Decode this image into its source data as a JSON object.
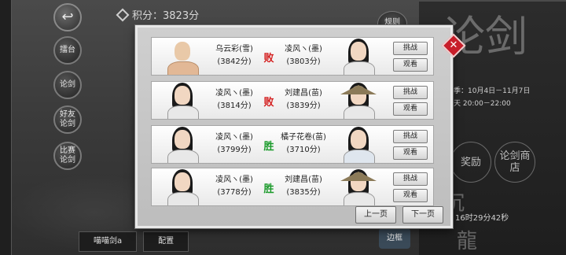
{
  "header": {
    "score_text": "积分：3823分",
    "top_tab": "规则"
  },
  "sidebar": {
    "items": [
      {
        "label": "擂台"
      },
      {
        "label": "论剑"
      },
      {
        "label": "好友论剑"
      },
      {
        "label": "比赛论剑"
      }
    ]
  },
  "right_panel": {
    "big_text": "论剑",
    "date_line": "季：10月4日－11月7日",
    "time_line": "天 20:00－22:00",
    "circle_left": "奖励",
    "circle_right": "论剑商店",
    "mid_big": "沉",
    "countdown": "16时29分42秒",
    "bottom_big": "龍"
  },
  "bottom": {
    "chip1": "喵喵剑a",
    "chip2": "配置",
    "tag": "边框"
  },
  "modal": {
    "close_icon": "close-x",
    "rows": [
      {
        "left_name": "乌云彩(雪)",
        "left_score": "(3842分)",
        "result": "败",
        "result_color": "#d42020",
        "right_name": "凌风ヽ(墨)",
        "right_score": "(3803分)",
        "challenge": "挑战",
        "watch": "观看"
      },
      {
        "left_name": "凌风ヽ(墨)",
        "left_score": "(3814分)",
        "result": "败",
        "result_color": "#d42020",
        "right_name": "刘建昌(苗)",
        "right_score": "(3839分)",
        "challenge": "挑战",
        "watch": "观看"
      },
      {
        "left_name": "凌风ヽ(墨)",
        "left_score": "(3799分)",
        "result": "胜",
        "result_color": "#1a9a2a",
        "right_name": "橘子花卷(苗)",
        "right_score": "(3710分)",
        "challenge": "挑战",
        "watch": "观看"
      },
      {
        "left_name": "凌风ヽ(墨)",
        "left_score": "(3778分)",
        "result": "胜",
        "result_color": "#1a9a2a",
        "right_name": "刘建昌(苗)",
        "right_score": "(3835分)",
        "challenge": "挑战",
        "watch": "观看"
      }
    ],
    "prev_label": "上一页",
    "next_label": "下一页"
  }
}
